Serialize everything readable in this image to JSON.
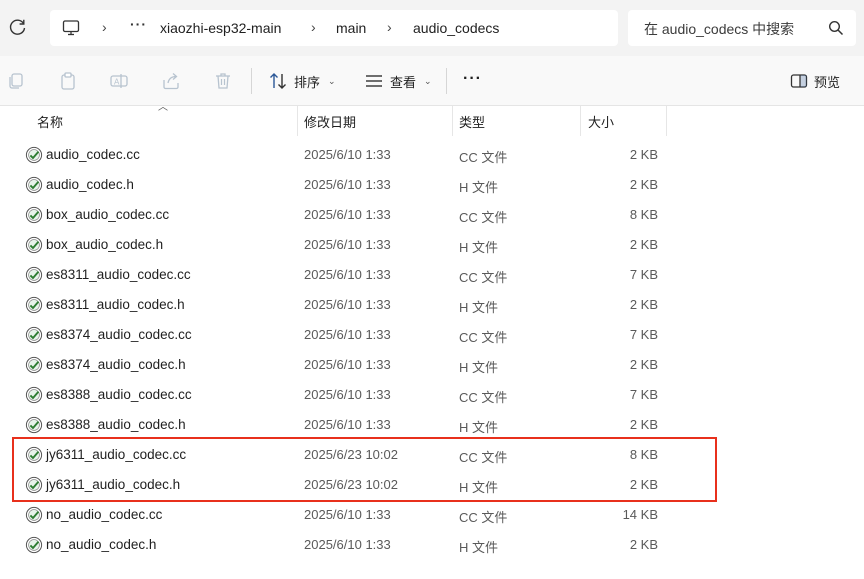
{
  "address_bar": {
    "breadcrumbs": [
      "xiaozhi-esp32-main",
      "main",
      "audio_codecs"
    ],
    "overflow": "···",
    "search_placeholder": "在 audio_codecs 中搜索"
  },
  "toolbar": {
    "sort_label": "排序",
    "view_label": "查看",
    "more_label": "···",
    "preview_label": "预览"
  },
  "columns": {
    "name": "名称",
    "date": "修改日期",
    "type": "类型",
    "size": "大小"
  },
  "files": [
    {
      "name": "audio_codec.cc",
      "date": "2025/6/10 1:33",
      "type": "CC 文件",
      "size": "2 KB"
    },
    {
      "name": "audio_codec.h",
      "date": "2025/6/10 1:33",
      "type": "H 文件",
      "size": "2 KB"
    },
    {
      "name": "box_audio_codec.cc",
      "date": "2025/6/10 1:33",
      "type": "CC 文件",
      "size": "8 KB"
    },
    {
      "name": "box_audio_codec.h",
      "date": "2025/6/10 1:33",
      "type": "H 文件",
      "size": "2 KB"
    },
    {
      "name": "es8311_audio_codec.cc",
      "date": "2025/6/10 1:33",
      "type": "CC 文件",
      "size": "7 KB"
    },
    {
      "name": "es8311_audio_codec.h",
      "date": "2025/6/10 1:33",
      "type": "H 文件",
      "size": "2 KB"
    },
    {
      "name": "es8374_audio_codec.cc",
      "date": "2025/6/10 1:33",
      "type": "CC 文件",
      "size": "7 KB"
    },
    {
      "name": "es8374_audio_codec.h",
      "date": "2025/6/10 1:33",
      "type": "H 文件",
      "size": "2 KB"
    },
    {
      "name": "es8388_audio_codec.cc",
      "date": "2025/6/10 1:33",
      "type": "CC 文件",
      "size": "7 KB"
    },
    {
      "name": "es8388_audio_codec.h",
      "date": "2025/6/10 1:33",
      "type": "H 文件",
      "size": "2 KB"
    },
    {
      "name": "jy6311_audio_codec.cc",
      "date": "2025/6/23 10:02",
      "type": "CC 文件",
      "size": "8 KB"
    },
    {
      "name": "jy6311_audio_codec.h",
      "date": "2025/6/23 10:02",
      "type": "H 文件",
      "size": "2 KB"
    },
    {
      "name": "no_audio_codec.cc",
      "date": "2025/6/10 1:33",
      "type": "CC 文件",
      "size": "14 KB"
    },
    {
      "name": "no_audio_codec.h",
      "date": "2025/6/10 1:33",
      "type": "H 文件",
      "size": "2 KB"
    }
  ],
  "colors": {
    "highlight": "#e8301c",
    "file_icon": "#2e7d32"
  }
}
